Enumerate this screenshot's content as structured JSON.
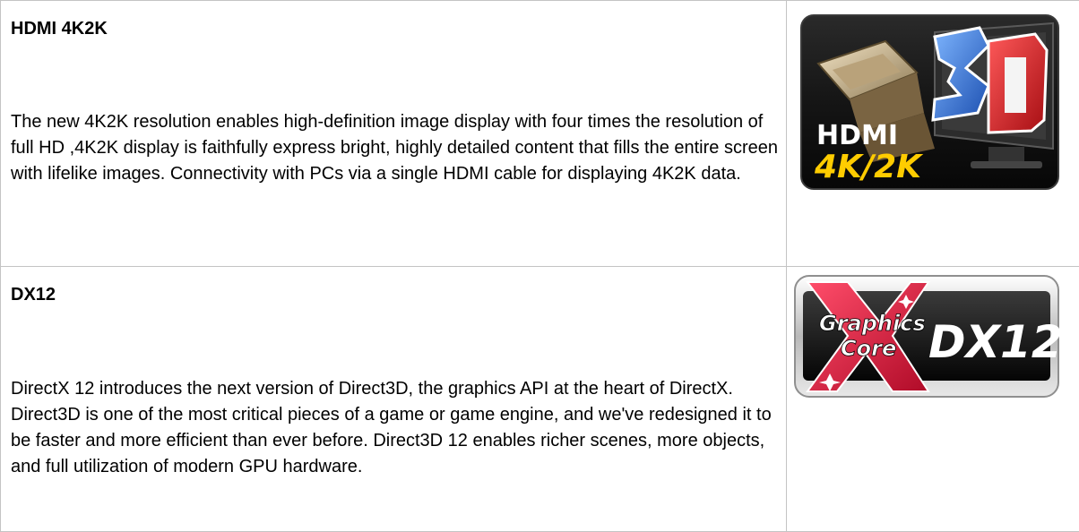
{
  "features": [
    {
      "title": "HDMI 4K2K",
      "description": "The new 4K2K resolution enables high-definition image display with four times the resolution of full HD ,4K2K display is faithfully express bright, highly detailed content that fills the entire screen with lifelike images. Connectivity with PCs via a single HDMI cable for displaying 4K2K data.",
      "badge": {
        "line1": "HDMI",
        "line2": "4K/2K",
        "accent": "3D",
        "icon": "hdmi-3d-4k2k-logo"
      }
    },
    {
      "title": "DX12",
      "description": "DirectX 12 introduces the next version of Direct3D, the graphics API at the heart of DirectX. Direct3D is one of the most critical pieces of a game or game engine, and we've redesigned it to be faster and more efficient than ever before. Direct3D 12 enables richer scenes, more objects, and full utilization of modern GPU hardware.",
      "badge": {
        "line1": "Graphics",
        "line2": "Core",
        "accent": "DX12",
        "icon": "graphics-core-dx12-logo"
      }
    }
  ],
  "colors": {
    "border": "#c4c4c4",
    "badge_blue": "#2a6fd6",
    "badge_red": "#d4131b",
    "badge_yellow": "#ffcc00",
    "badge_dark": "#161616"
  }
}
